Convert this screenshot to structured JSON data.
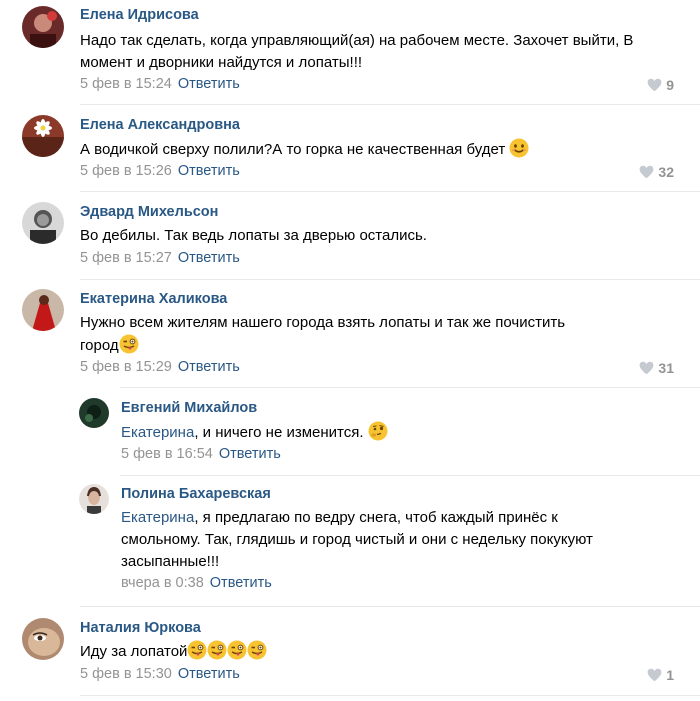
{
  "comments": [
    {
      "author": "Елена Идрисова",
      "text": "Надо так сделать, когда управляющий(ая) на рабочем месте. Захочет выйти, В момент и дворники найдутся и лопаты!!!",
      "time": "5 фев в 15:24",
      "reply_label": "Ответить",
      "likes": "9"
    },
    {
      "author": "Елена Александровна",
      "text": "А водичкой сверху полили?А то горка не качественная будет",
      "time": "5 фев в 15:26",
      "reply_label": "Ответить",
      "likes": "32"
    },
    {
      "author": "Эдвард Михельсон",
      "text": "Во дебилы. Так ведь лопаты за дверью остались.",
      "time": "5 фев в 15:27",
      "reply_label": "Ответить",
      "likes": ""
    },
    {
      "author": "Екатерина Халикова",
      "text_line1": "Нужно всем жителям нашего города взять лопаты и так же почистить",
      "text_line2": "город",
      "time": "5 фев в 15:29",
      "reply_label": "Ответить",
      "likes": "31"
    },
    {
      "author": "Евгений Михайлов",
      "mention": "Екатерина",
      "text": ", и ничего не изменится.",
      "time": "5 фев в 16:54",
      "reply_label": "Ответить"
    },
    {
      "author": "Полина Бахаревская",
      "mention": "Екатерина",
      "text_line1": ", я предлагаю по ведру снега, чтоб каждый принёс к",
      "text_line2": "смольному. Так, глядишь и город чистый и они с недельку покукуют",
      "text_line3": "засыпанные!!!",
      "time": "вчера в 0:38",
      "reply_label": "Ответить"
    },
    {
      "author": "Наталия Юркова",
      "text": "Иду за лопатой",
      "time": "5 фев в 15:30",
      "reply_label": "Ответить",
      "likes": "1"
    }
  ],
  "colors": {
    "link": "#2a5885",
    "meta": "#939393",
    "divider": "#e7e8ec"
  },
  "icons": [
    "heart-icon",
    "smile-emoji",
    "winking-tongue-emoji",
    "thinking-emoji"
  ]
}
